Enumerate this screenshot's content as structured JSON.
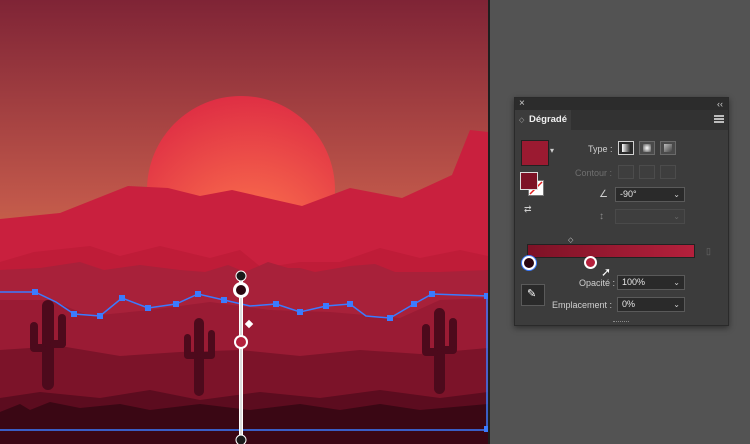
{
  "panel": {
    "title": "Dégradé",
    "type_label": "Type :",
    "stroke_label": "Contour :",
    "angle_value": "-90°",
    "opacity_label": "Opacité :",
    "opacity_value": "100%",
    "location_label": "Emplacement :",
    "location_value": "0%",
    "gradient_start_color": "#7d1226",
    "gradient_end_color": "#b5203c"
  },
  "icons": {
    "close": "×",
    "collapse": "‹‹",
    "dropdown_arrow": "⌄"
  },
  "colors": {
    "sky_top": "#8a2a3a",
    "sky_bottom": "#f0a63e",
    "sun": "#f0514a",
    "hill_front": "#5a1020",
    "gradient_handle": "#2f6bff",
    "panel_bg": "#3c3c3c"
  }
}
